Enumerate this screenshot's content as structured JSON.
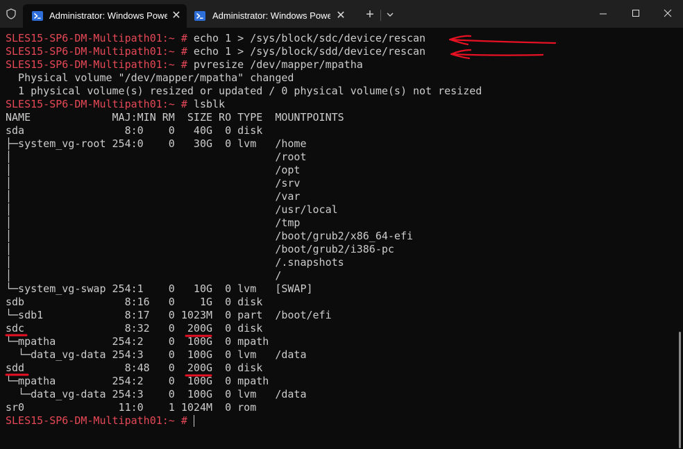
{
  "window": {
    "tabs": [
      {
        "title": "Administrator: Windows PowerShell",
        "active": true
      },
      {
        "title": "Administrator: Windows PowerShell",
        "active": false
      }
    ],
    "new_tab_label": "+"
  },
  "colors": {
    "background": "#0c0c0c",
    "titlebar": "#202020",
    "prompt": "#e74856",
    "text": "#cccccc",
    "annotation": "#e81123",
    "powershell_icon": "#2d6ed8"
  },
  "icons": [
    "shield-icon",
    "powershell-icon",
    "close-icon",
    "plus-icon",
    "chevron-down-icon",
    "minimize-icon",
    "maximize-icon",
    "window-close-icon"
  ],
  "terminal": {
    "lines": [
      {
        "prompt": "SLES15-SP6-DM-Multipath01:~ #",
        "text": " echo 1 > /sys/block/sdc/device/rescan"
      },
      {
        "prompt": "SLES15-SP6-DM-Multipath01:~ #",
        "text": " echo 1 > /sys/block/sdd/device/rescan"
      },
      {
        "prompt": "SLES15-SP6-DM-Multipath01:~ #",
        "text": " pvresize /dev/mapper/mpatha"
      },
      {
        "prompt": "",
        "text": "  Physical volume \"/dev/mapper/mpatha\" changed"
      },
      {
        "prompt": "",
        "text": "  1 physical volume(s) resized or updated / 0 physical volume(s) not resized"
      },
      {
        "prompt": "SLES15-SP6-DM-Multipath01:~ #",
        "text": " lsblk"
      },
      {
        "prompt": "",
        "text": "NAME             MAJ:MIN RM  SIZE RO TYPE  MOUNTPOINTS"
      },
      {
        "prompt": "",
        "text": "sda                8:0    0   40G  0 disk"
      },
      {
        "prompt": "",
        "text": "├─system_vg-root 254:0    0   30G  0 lvm   /home"
      },
      {
        "prompt": "",
        "text": "│                                          /root"
      },
      {
        "prompt": "",
        "text": "│                                          /opt"
      },
      {
        "prompt": "",
        "text": "│                                          /srv"
      },
      {
        "prompt": "",
        "text": "│                                          /var"
      },
      {
        "prompt": "",
        "text": "│                                          /usr/local"
      },
      {
        "prompt": "",
        "text": "│                                          /tmp"
      },
      {
        "prompt": "",
        "text": "│                                          /boot/grub2/x86_64-efi"
      },
      {
        "prompt": "",
        "text": "│                                          /boot/grub2/i386-pc"
      },
      {
        "prompt": "",
        "text": "│                                          /.snapshots"
      },
      {
        "prompt": "",
        "text": "│                                          /"
      },
      {
        "prompt": "",
        "text": "└─system_vg-swap 254:1    0   10G  0 lvm   [SWAP]"
      },
      {
        "prompt": "",
        "text": "sdb                8:16   0    1G  0 disk"
      },
      {
        "prompt": "",
        "text": "└─sdb1             8:17   0 1023M  0 part  /boot/efi"
      },
      {
        "prompt": "",
        "text": "sdc                8:32   0  200G  0 disk"
      },
      {
        "prompt": "",
        "text": "└─mpatha         254:2    0  100G  0 mpath"
      },
      {
        "prompt": "",
        "text": "  └─data_vg-data 254:3    0  100G  0 lvm   /data"
      },
      {
        "prompt": "",
        "text": "sdd                8:48   0  200G  0 disk"
      },
      {
        "prompt": "",
        "text": "└─mpatha         254:2    0  100G  0 mpath"
      },
      {
        "prompt": "",
        "text": "  └─data_vg-data 254:3    0  100G  0 lvm   /data"
      },
      {
        "prompt": "",
        "text": "sr0               11:0    1 1024M  0 rom"
      },
      {
        "prompt": "SLES15-SP6-DM-Multipath01:~ #",
        "text": " "
      }
    ]
  }
}
